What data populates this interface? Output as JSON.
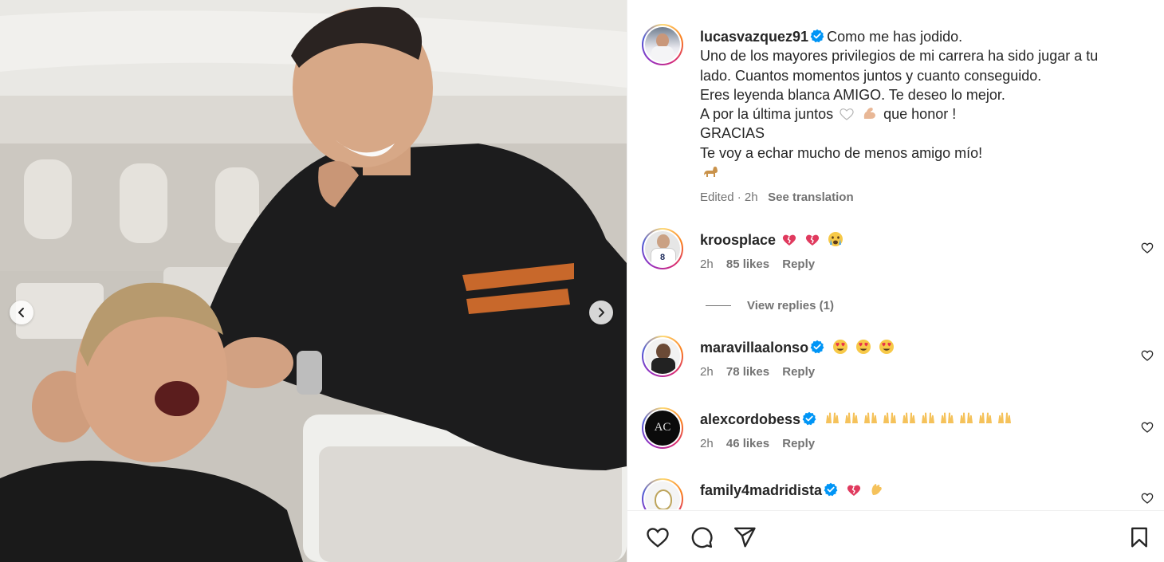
{
  "post": {
    "author": "lucasvazquez91",
    "caption_lines": [
      "Como me has jodido.",
      "Uno de los mayores privilegios de mi carrera ha sido jugar a tu",
      "lado. Cuantos momentos juntos y cuanto conseguido.",
      "Eres leyenda blanca AMIGO. Te deseo lo mejor.",
      "A por la última juntos",
      "que honor !",
      "GRACIAS",
      "Te voy a echar mucho de menos amigo mío!"
    ],
    "edited_label": "Edited",
    "time": "2h",
    "see_translation": "See translation"
  },
  "comments": [
    {
      "user": "kroosplace",
      "time": "2h",
      "likes": "85 likes",
      "reply": "Reply",
      "verified": false,
      "emojis": [
        "broken-heart-emoji",
        "broken-heart-emoji",
        "crying-face-emoji"
      ]
    },
    {
      "user": "maravillaalonso",
      "time": "2h",
      "likes": "78 likes",
      "reply": "Reply",
      "verified": true,
      "emojis": [
        "heart-eyes-emoji",
        "heart-eyes-emoji",
        "heart-eyes-emoji"
      ]
    },
    {
      "user": "alexcordobess",
      "time": "2h",
      "likes": "46 likes",
      "reply": "Reply",
      "verified": true,
      "emojis": [
        "raising-hands-emoji x10"
      ]
    },
    {
      "user": "family4madridista",
      "time": "",
      "likes": "",
      "reply": "",
      "verified": true,
      "emojis": [
        "broken-heart-emoji",
        "clapping-hands-emoji"
      ]
    }
  ],
  "view_replies": "View replies (1)",
  "icons": {
    "like": "heart-icon",
    "comment": "comment-icon",
    "share": "paper-plane-icon",
    "save": "bookmark-icon",
    "prev": "chevron-left-icon",
    "next": "chevron-right-icon"
  },
  "colors": {
    "verified": "#0095f6",
    "muted": "#737373",
    "text": "#262626"
  }
}
